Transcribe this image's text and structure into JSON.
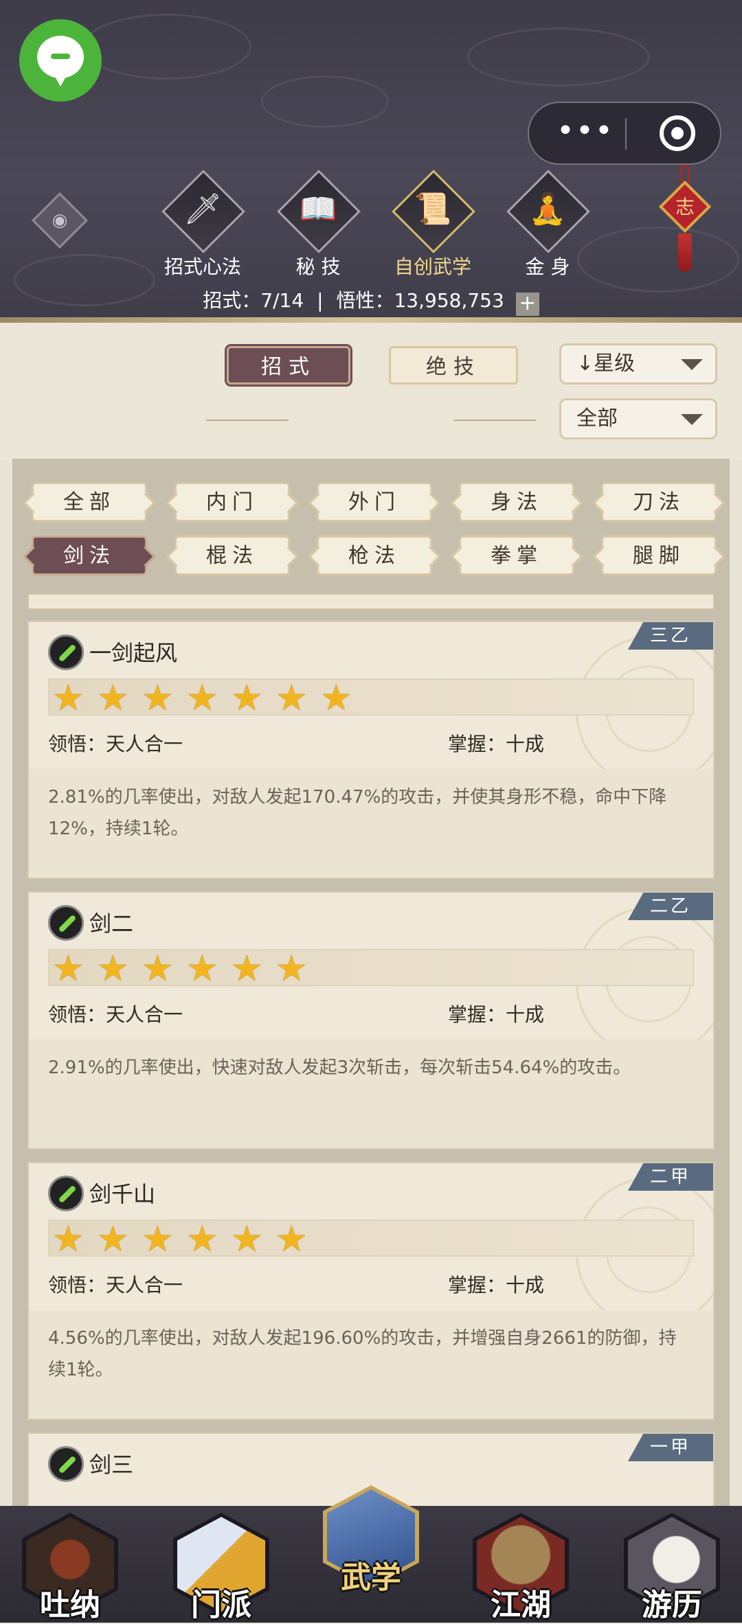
{
  "header": {
    "top_tabs": [
      {
        "label": "招式心法",
        "icon": "sword-icon",
        "glyph": "🗡"
      },
      {
        "label": "秘 技",
        "icon": "book-icon",
        "glyph": "📖"
      },
      {
        "label": "自创武学",
        "icon": "scroll-icon",
        "glyph": "📜"
      },
      {
        "label": "金 身",
        "icon": "meditation-icon",
        "glyph": "🧘"
      }
    ],
    "knot_char": "志",
    "stats": {
      "moves_label": "招式：",
      "moves_value": "7/14",
      "sep": "|",
      "insight_label": "悟性：",
      "insight_value": "13,958,753",
      "plus": "+"
    }
  },
  "filters": {
    "type_tabs": [
      {
        "label": "招式",
        "selected": true
      },
      {
        "label": "绝技",
        "selected": false
      }
    ],
    "sort_dropdown": {
      "arrow": "↓",
      "label": "星级"
    },
    "scope_dropdown": {
      "label": "全部"
    }
  },
  "categories": [
    {
      "label": "全部",
      "selected": false
    },
    {
      "label": "内门",
      "selected": false
    },
    {
      "label": "外门",
      "selected": false
    },
    {
      "label": "身法",
      "selected": false
    },
    {
      "label": "刀法",
      "selected": false
    },
    {
      "label": "剑法",
      "selected": true
    },
    {
      "label": "棍法",
      "selected": false
    },
    {
      "label": "枪法",
      "selected": false
    },
    {
      "label": "拳掌",
      "selected": false
    },
    {
      "label": "腿脚",
      "selected": false
    }
  ],
  "skills": [
    {
      "name": "一剑起风",
      "grade": "三乙",
      "stars": 7,
      "comprehension_label": "领悟：",
      "comprehension": "天人合一",
      "mastery_label": "掌握：",
      "mastery": "十成",
      "desc": "2.81%的几率使出，对敌人发起170.47%的攻击，并使其身形不稳，命中下降12%，持续1轮。"
    },
    {
      "name": "剑二",
      "grade": "二乙",
      "stars": 6,
      "comprehension_label": "领悟：",
      "comprehension": "天人合一",
      "mastery_label": "掌握：",
      "mastery": "十成",
      "desc": "2.91%的几率使出，快速对敌人发起3次斩击，每次斩击54.64%的攻击。"
    },
    {
      "name": "剑千山",
      "grade": "二甲",
      "stars": 6,
      "comprehension_label": "领悟：",
      "comprehension": "天人合一",
      "mastery_label": "掌握：",
      "mastery": "十成",
      "desc": "4.56%的几率使出，对敌人发起196.60%的攻击，并增强自身2661的防御，持续1轮。"
    },
    {
      "name": "剑三",
      "grade": "一甲",
      "stars": 0,
      "comprehension_label": "",
      "comprehension": "",
      "mastery_label": "",
      "mastery": "",
      "desc": ""
    }
  ],
  "bottom_nav": [
    {
      "label": "吐纳",
      "icon": "monk-icon",
      "active": false,
      "color": "#6a2d1e"
    },
    {
      "label": "门派",
      "icon": "banner-icon",
      "active": false,
      "color": "#3f5f9a"
    },
    {
      "label": "武学",
      "icon": "manual-book-icon",
      "active": true,
      "color": "#3f67a8"
    },
    {
      "label": "江湖",
      "icon": "straw-hat-icon",
      "active": false,
      "color": "#8a6a3a"
    },
    {
      "label": "游历",
      "icon": "horse-icon",
      "active": false,
      "color": "#b9b4ad"
    }
  ]
}
